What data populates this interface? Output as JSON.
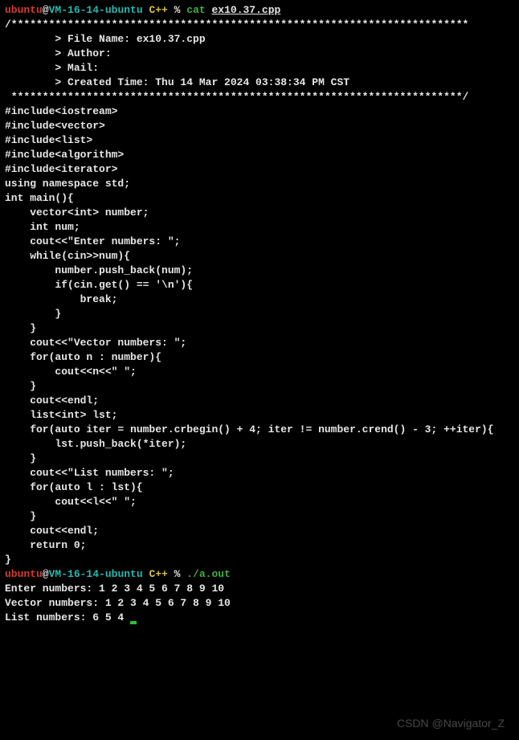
{
  "prompt1": {
    "user": "ubuntu",
    "at": "@",
    "host": "VM-16-14-ubuntu",
    "dir": " C++ ",
    "sep": "% ",
    "cmd": "cat ",
    "arg": "ex10.37.cpp"
  },
  "code": {
    "l1": "/*************************************************************************",
    "l2": "        > File Name: ex10.37.cpp",
    "l3": "        > Author:",
    "l4": "        > Mail:",
    "l5": "        > Created Time: Thu 14 Mar 2024 03:38:34 PM CST",
    "l6": " ************************************************************************/",
    "l7": "",
    "l8": "#include<iostream>",
    "l9": "#include<vector>",
    "l10": "#include<list>",
    "l11": "#include<algorithm>",
    "l12": "#include<iterator>",
    "l13": "using namespace std;",
    "l14": "",
    "l15": "int main(){",
    "l16": "    vector<int> number;",
    "l17": "    int num;",
    "l18": "    cout<<\"Enter numbers: \";",
    "l19": "    while(cin>>num){",
    "l20": "        number.push_back(num);",
    "l21": "        if(cin.get() == '\\n'){",
    "l22": "            break;",
    "l23": "        }",
    "l24": "    }",
    "l25": "",
    "l26": "    cout<<\"Vector numbers: \";",
    "l27": "    for(auto n : number){",
    "l28": "        cout<<n<<\" \";",
    "l29": "    }",
    "l30": "    cout<<endl;",
    "l31": "",
    "l32": "    list<int> lst;",
    "l33": "    for(auto iter = number.crbegin() + 4; iter != number.crend() - 3; ++iter){",
    "l34": "        lst.push_back(*iter);",
    "l35": "    }",
    "l36": "    cout<<\"List numbers: \";",
    "l37": "    for(auto l : lst){",
    "l38": "        cout<<l<<\" \";",
    "l39": "    }",
    "l40": "    cout<<endl;",
    "l41": "",
    "l42": "    return 0;",
    "l43": "}"
  },
  "prompt2": {
    "user": "ubuntu",
    "at": "@",
    "host": "VM-16-14-ubuntu",
    "dir": " C++ ",
    "sep": "% ",
    "cmd": "./a.out"
  },
  "output": {
    "o1": "Enter numbers: 1 2 3 4 5 6 7 8 9 10",
    "o2": "Vector numbers: 1 2 3 4 5 6 7 8 9 10",
    "o3": "List numbers: 6 5 4"
  },
  "watermark": "CSDN @Navigator_Z"
}
